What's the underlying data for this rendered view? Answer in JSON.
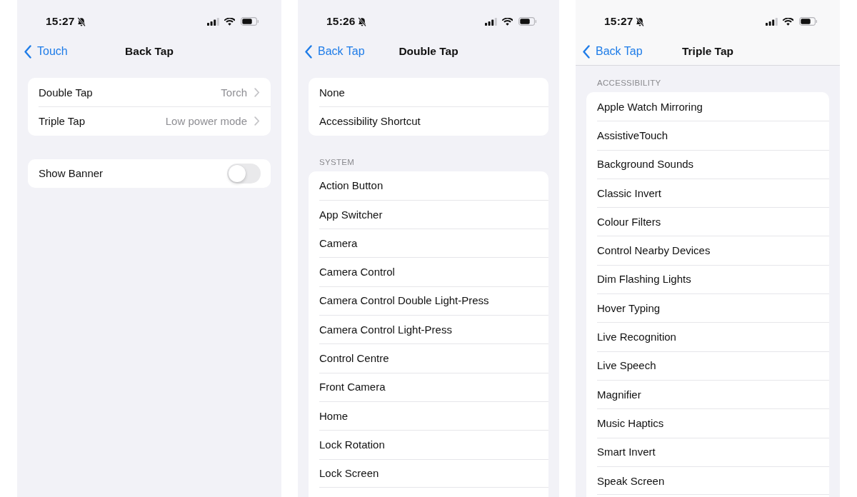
{
  "screens": [
    {
      "status_bar": {
        "time": "15:27"
      },
      "nav": {
        "back": "Touch",
        "title": "Back Tap"
      },
      "groups": [
        {
          "rows": [
            {
              "kind": "link",
              "label": "Double Tap",
              "value": "Torch"
            },
            {
              "kind": "link",
              "label": "Triple Tap",
              "value": "Low power mode"
            }
          ]
        },
        {
          "rows": [
            {
              "kind": "toggle",
              "label": "Show Banner",
              "on": false
            }
          ]
        }
      ]
    },
    {
      "status_bar": {
        "time": "15:26"
      },
      "nav": {
        "back": "Back Tap",
        "title": "Double Tap"
      },
      "groups": [
        {
          "rows": [
            {
              "kind": "option",
              "label": "None",
              "selected": false
            },
            {
              "kind": "option",
              "label": "Accessibility Shortcut",
              "selected": false
            }
          ]
        },
        {
          "header": "SYSTEM",
          "continues": true,
          "rows": [
            {
              "kind": "option",
              "label": "Action Button",
              "selected": false
            },
            {
              "kind": "option",
              "label": "App Switcher",
              "selected": false
            },
            {
              "kind": "option",
              "label": "Camera",
              "selected": false
            },
            {
              "kind": "option",
              "label": "Camera Control",
              "selected": false
            },
            {
              "kind": "option",
              "label": "Camera Control Double Light-Press",
              "selected": false
            },
            {
              "kind": "option",
              "label": "Camera Control Light-Press",
              "selected": false
            },
            {
              "kind": "option",
              "label": "Control Centre",
              "selected": false
            },
            {
              "kind": "option",
              "label": "Front Camera",
              "selected": false
            },
            {
              "kind": "option",
              "label": "Home",
              "selected": false
            },
            {
              "kind": "option",
              "label": "Lock Rotation",
              "selected": false
            },
            {
              "kind": "option",
              "label": "Lock Screen",
              "selected": false
            }
          ]
        }
      ]
    },
    {
      "status_bar": {
        "time": "15:27"
      },
      "nav": {
        "back": "Back Tap",
        "title": "Triple Tap",
        "scrolled": true
      },
      "groups": [
        {
          "header": "ACCESSIBILITY",
          "continues": true,
          "rows": [
            {
              "kind": "option",
              "label": "Apple Watch Mirroring",
              "selected": false
            },
            {
              "kind": "option",
              "label": "AssistiveTouch",
              "selected": false
            },
            {
              "kind": "option",
              "label": "Background Sounds",
              "selected": false
            },
            {
              "kind": "option",
              "label": "Classic Invert",
              "selected": false
            },
            {
              "kind": "option",
              "label": "Colour Filters",
              "selected": false
            },
            {
              "kind": "option",
              "label": "Control Nearby Devices",
              "selected": false
            },
            {
              "kind": "option",
              "label": "Dim Flashing Lights",
              "selected": false
            },
            {
              "kind": "option",
              "label": "Hover Typing",
              "selected": false
            },
            {
              "kind": "option",
              "label": "Live Recognition",
              "selected": false
            },
            {
              "kind": "option",
              "label": "Live Speech",
              "selected": false
            },
            {
              "kind": "option",
              "label": "Magnifier",
              "selected": false
            },
            {
              "kind": "option",
              "label": "Music Haptics",
              "selected": false
            },
            {
              "kind": "option",
              "label": "Smart Invert",
              "selected": false
            },
            {
              "kind": "option",
              "label": "Speak Screen",
              "selected": false
            }
          ]
        }
      ]
    }
  ]
}
